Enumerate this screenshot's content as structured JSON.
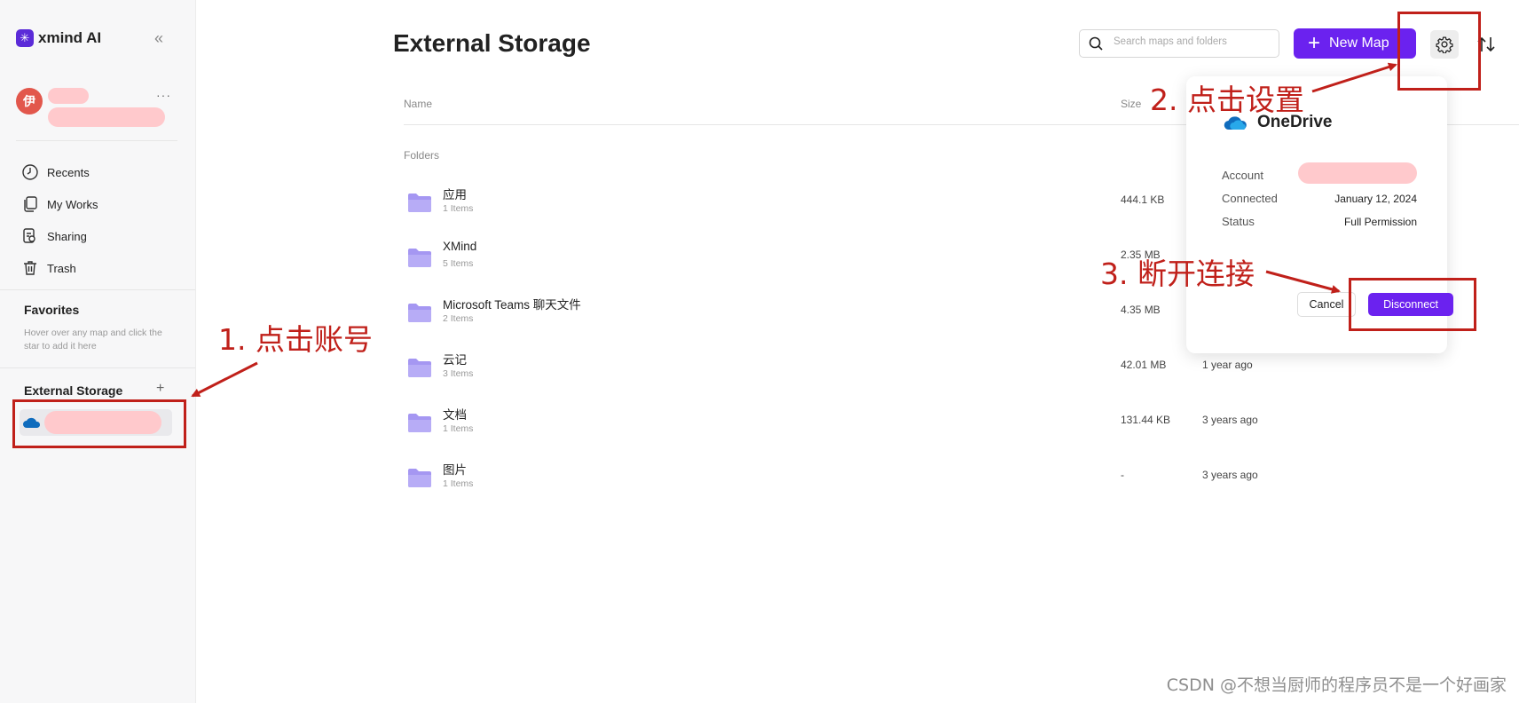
{
  "app": {
    "logo_text": "xmind AI",
    "logo_mark": "✳"
  },
  "sidebar": {
    "collapse_icon": "«",
    "user": {
      "avatar_initial": "伊",
      "more": "···"
    },
    "nav": [
      {
        "label": "Recents",
        "icon": "clock-icon"
      },
      {
        "label": "My Works",
        "icon": "documents-icon"
      },
      {
        "label": "Sharing",
        "icon": "sharing-icon"
      },
      {
        "label": "Trash",
        "icon": "trash-icon"
      }
    ],
    "favorites": {
      "title": "Favorites",
      "hint": "Hover over any map and click the star to add it here"
    },
    "external_storage": {
      "title": "External Storage",
      "add": "+"
    }
  },
  "main": {
    "title": "External Storage",
    "search_placeholder": "Search maps and folders",
    "new_map_plus": "+",
    "new_map_label": "New Map",
    "columns": {
      "name": "Name",
      "size": "Size"
    },
    "section": "Folders",
    "folders": [
      {
        "name": "应用",
        "items": "1 Items",
        "size": "444.1 KB",
        "date": ""
      },
      {
        "name": "XMind",
        "items": "5 Items",
        "size": "2.35 MB",
        "date": ""
      },
      {
        "name": "Microsoft Teams 聊天文件",
        "items": "2 Items",
        "size": "4.35 MB",
        "date": ""
      },
      {
        "name": "云记",
        "items": "3 Items",
        "size": "42.01 MB",
        "date": "1 year ago"
      },
      {
        "name": "文档",
        "items": "1 Items",
        "size": "131.44 KB",
        "date": "3 years ago"
      },
      {
        "name": "图片",
        "items": "1 Items",
        "size": "-",
        "date": "3 years ago"
      }
    ]
  },
  "popover": {
    "title": "OneDrive",
    "account_label": "Account",
    "connected_label": "Connected",
    "connected_value": "January 12, 2024",
    "status_label": "Status",
    "status_value": "Full Permission",
    "cancel": "Cancel",
    "disconnect": "Disconnect"
  },
  "annotations": {
    "step1": "1. 点击账号",
    "step2": "2. 点击设置",
    "step3": "3. 断开连接",
    "color": "#c0201a"
  },
  "watermark": "CSDN @不想当厨师的程序员不是一个好画家",
  "colors": {
    "accent": "#6b22ef",
    "onedrive": "#0f6cbd",
    "folder": "#a597f2",
    "redaction": "#ffc9cc"
  }
}
